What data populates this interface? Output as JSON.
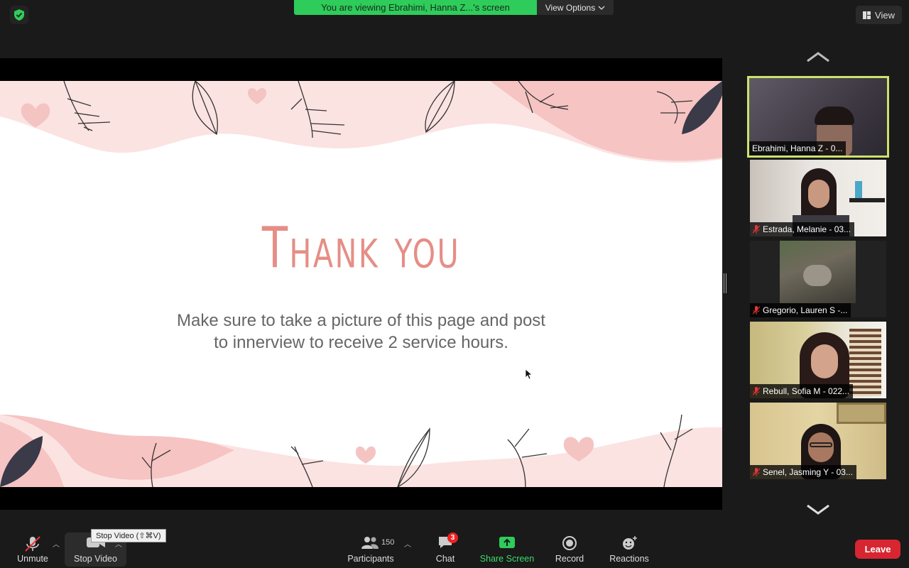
{
  "top": {
    "banner_text": "You are viewing Ebrahimi, Hanna Z...'s screen",
    "view_options_label": "View Options",
    "view_button_label": "View"
  },
  "slide": {
    "title": "Thank you",
    "body_line1": "Make sure to take a picture of this page and post",
    "body_line2": "to innerview to receive 2 service hours."
  },
  "gallery": {
    "participants": [
      {
        "name": "Ebrahimi, Hanna Z - 0...",
        "muted": false,
        "active": true
      },
      {
        "name": "Estrada, Melanie - 03...",
        "muted": true,
        "active": false
      },
      {
        "name": "Gregorio, Lauren S -...",
        "muted": true,
        "active": false
      },
      {
        "name": "Rebull, Sofia M - 022...",
        "muted": true,
        "active": false
      },
      {
        "name": "Senel, Jasming Y - 03...",
        "muted": true,
        "active": false
      }
    ]
  },
  "toolbar": {
    "unmute_label": "Unmute",
    "stop_video_label": "Stop Video",
    "stop_video_tooltip": "Stop Video (⇧⌘V)",
    "participants_label": "Participants",
    "participants_count": "150",
    "chat_label": "Chat",
    "chat_badge": "3",
    "share_label": "Share Screen",
    "record_label": "Record",
    "reactions_label": "Reactions",
    "leave_label": "Leave"
  },
  "colors": {
    "banner_green": "#2ecc5a",
    "active_speaker_border": "#cde26a",
    "share_green": "#3dd96b",
    "leave_red": "#d72631",
    "slide_title_pink": "#e58e86"
  }
}
